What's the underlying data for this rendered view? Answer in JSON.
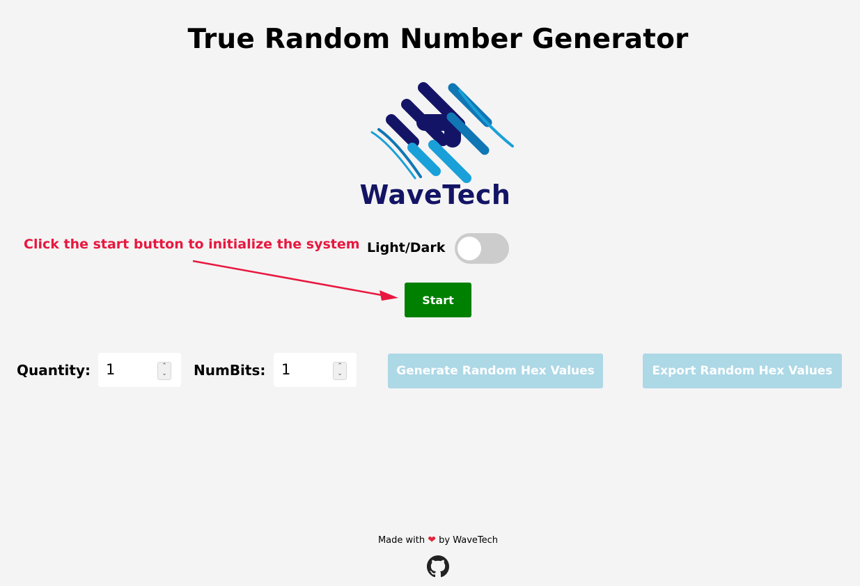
{
  "page": {
    "title": "True Random Number Generator"
  },
  "logo": {
    "text": "WaveTech",
    "icon": "wavetech-logo-icon",
    "colors": {
      "dark": "#141466",
      "light": "#1aa0d8",
      "mid": "#1076b4"
    }
  },
  "hint": {
    "text": "Click the start button to initialize the system",
    "color": "#e8173f"
  },
  "theme_toggle": {
    "label": "Light/Dark",
    "state": "light"
  },
  "start_button": {
    "label": "Start",
    "color": "#008000"
  },
  "inputs": {
    "quantity": {
      "label": "Quantity:",
      "value": "1"
    },
    "numbits": {
      "label": "NumBits:",
      "value": "1"
    }
  },
  "actions": {
    "generate_label": "Generate Random Hex Values",
    "export_label": "Export Random Hex Values",
    "disabled_color": "#add8e6"
  },
  "footer": {
    "made_with": "Made with",
    "by": "by WaveTech",
    "heart_icon": "heart-icon",
    "github_icon": "github-icon"
  }
}
